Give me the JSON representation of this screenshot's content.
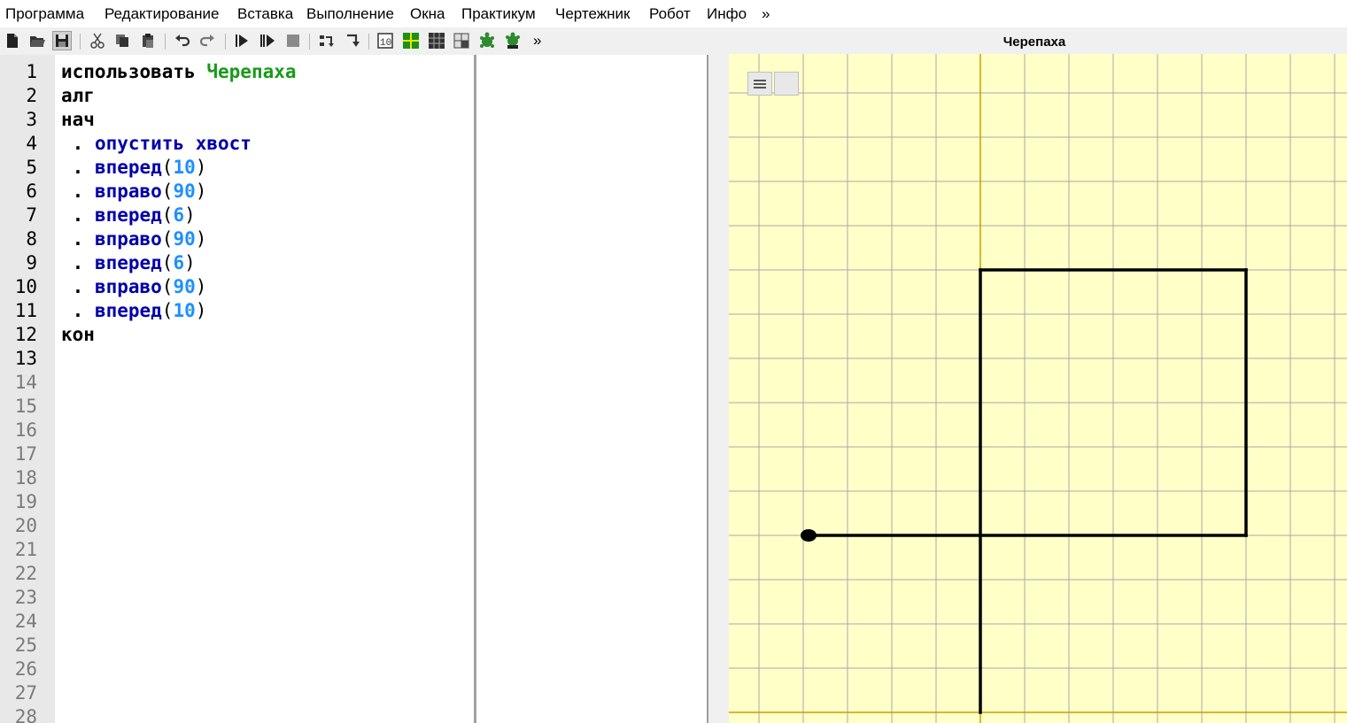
{
  "menu": [
    "Программа",
    "Редактирование",
    "Вставка",
    "Выполнение",
    "Окна",
    "Практикум",
    "Чертежник",
    "Робот",
    "Инфо",
    "»"
  ],
  "toolbar": {
    "icons": [
      "new-file-icon",
      "open-folder-icon",
      "save-icon",
      "cut-icon",
      "copy-icon",
      "paste-icon",
      "undo-icon",
      "redo-icon",
      "run-icon",
      "step-run-icon",
      "stop-icon",
      "step-into-icon",
      "step-out-icon",
      "counter-icon",
      "grid-icon",
      "grid-dark-icon",
      "robot-icon",
      "turtle-icon",
      "turtle-pen-icon"
    ],
    "overflow_label": "»"
  },
  "editor": {
    "line_numbers": [
      "1",
      "2",
      "3",
      "4",
      "5",
      "6",
      "7",
      "8",
      "9",
      "10",
      "11",
      "12",
      "13",
      "14",
      "15",
      "16",
      "17",
      "18",
      "19",
      "20",
      "21",
      "22",
      "23",
      "24",
      "25",
      "26",
      "27",
      "28"
    ],
    "active_line_count": 13,
    "lines": [
      {
        "kw": "использовать ",
        "mod": "Черепаха"
      },
      {
        "kw": "алг"
      },
      {
        "kw": "нач"
      },
      {
        "dot": " . ",
        "cmd": "опустить хвост"
      },
      {
        "dot": " . ",
        "cmd": "вперед",
        "open": "(",
        "num": "10",
        "close": ")"
      },
      {
        "dot": " . ",
        "cmd": "вправо",
        "open": "(",
        "num": "90",
        "close": ")"
      },
      {
        "dot": " . ",
        "cmd": "вперед",
        "open": "(",
        "num": "6",
        "close": ")"
      },
      {
        "dot": " . ",
        "cmd": "вправо",
        "open": "(",
        "num": "90",
        "close": ")"
      },
      {
        "dot": " . ",
        "cmd": "вперед",
        "open": "(",
        "num": "6",
        "close": ")"
      },
      {
        "dot": " . ",
        "cmd": "вправо",
        "open": "(",
        "num": "90",
        "close": ")"
      },
      {
        "dot": " . ",
        "cmd": "вперед",
        "open": "(",
        "num": "10",
        "close": ")"
      },
      {
        "kw": "кон"
      }
    ]
  },
  "turtle_panel": {
    "title": "Черепаха",
    "path_steps": [
      {
        "dir": "up",
        "len": 10
      },
      {
        "dir": "right",
        "len": 6
      },
      {
        "dir": "down",
        "len": 6
      },
      {
        "dir": "left",
        "len": 10
      }
    ],
    "colors": {
      "background": "#ffffc8",
      "grid": "#a8a8a8",
      "axis": "#c8a000",
      "path": "#000000"
    }
  }
}
